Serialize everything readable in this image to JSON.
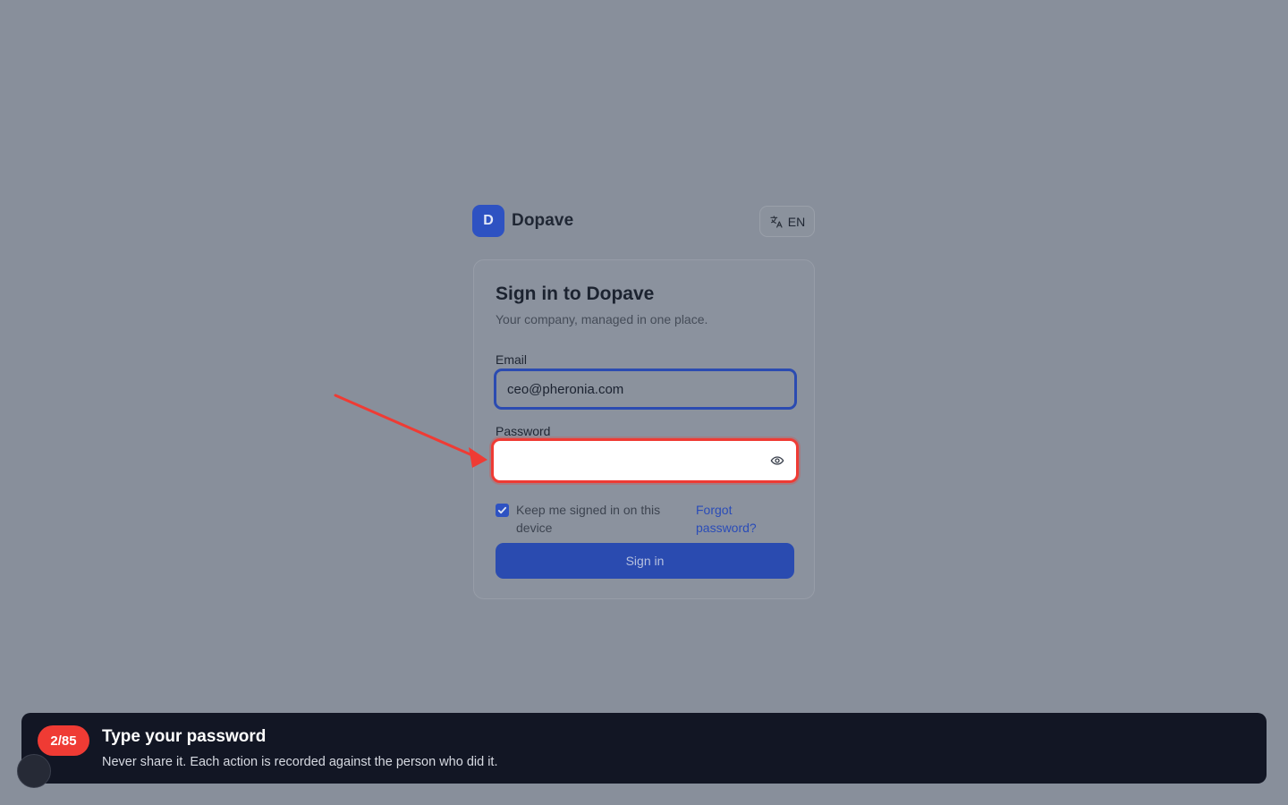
{
  "brand": {
    "logo_letter": "D",
    "name": "Dopave",
    "accent": "#2e52c2"
  },
  "language": {
    "icon": "translate-icon",
    "label": "EN"
  },
  "form": {
    "title": "Sign in to Dopave",
    "subtitle": "Your company, managed in one place.",
    "email": {
      "label": "Email",
      "value": "ceo@pheronia.com"
    },
    "password": {
      "label": "Password",
      "value": "",
      "toggle_icon": "eye-icon"
    },
    "remember": {
      "label": "Keep me signed in on this device",
      "checked": true
    },
    "forgot_label": "Forgot password?",
    "submit_label": "Sign in"
  },
  "tour": {
    "step": "2/85",
    "title": "Type your password",
    "description": "Never share it. Each action is recorded against the person who did it.",
    "highlight_color": "#ef3b34"
  }
}
